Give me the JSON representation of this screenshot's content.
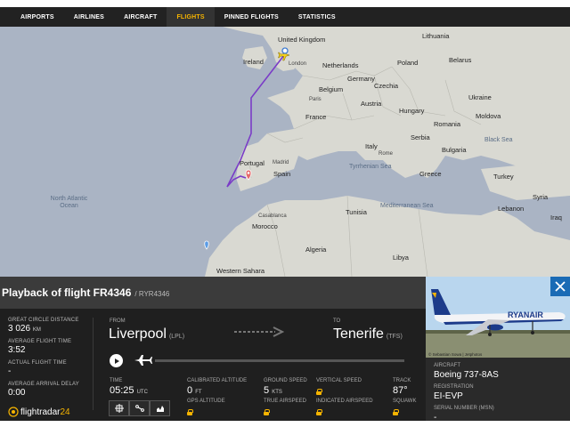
{
  "nav": {
    "items": [
      {
        "label": "AIRPORTS",
        "active": false
      },
      {
        "label": "AIRLINES",
        "active": false
      },
      {
        "label": "AIRCRAFT",
        "active": false
      },
      {
        "label": "FLIGHTS",
        "active": true
      },
      {
        "label": "PINNED FLIGHTS",
        "active": false
      },
      {
        "label": "STATISTICS",
        "active": false
      }
    ]
  },
  "map": {
    "countries": [
      "United Kingdom",
      "Ireland",
      "Netherlands",
      "Belgium",
      "Germany",
      "Poland",
      "Lithuania",
      "Belarus",
      "Czechia",
      "Ukraine",
      "France",
      "Austria",
      "Hungary",
      "Moldova",
      "Romania",
      "Italy",
      "Serbia",
      "Bulgaria",
      "Portugal",
      "Spain",
      "Greece",
      "Turkey",
      "Tunisia",
      "Morocco",
      "Algeria",
      "Libya",
      "Lebanon",
      "Syria",
      "Iraq",
      "Western Sahara"
    ],
    "seas": [
      "North Atlantic Ocean",
      "Black Sea",
      "Mediterranean Sea",
      "Tyrrhenian Sea"
    ],
    "cities": [
      "London",
      "Paris",
      "Madrid",
      "Rome",
      "Casablanca"
    ],
    "colors": {
      "land": "#d9d9d2",
      "water": "#aab4c4",
      "track": "#7a3cc7"
    }
  },
  "playback": {
    "title": "Playback of flight FR4346",
    "subtitle": "/ RYR4346"
  },
  "stats": {
    "distance_label": "GREAT CIRCLE DISTANCE",
    "distance_value": "3 026",
    "distance_unit": "KM",
    "avg_time_label": "AVERAGE FLIGHT TIME",
    "avg_time_value": "3:52",
    "actual_time_label": "ACTUAL FLIGHT TIME",
    "actual_time_value": "-",
    "avg_delay_label": "AVERAGE ARRIVAL DELAY",
    "avg_delay_value": "0:00"
  },
  "logo": {
    "text": "flightradar",
    "num": "24"
  },
  "route": {
    "from_label": "FROM",
    "from_city": "Liverpool",
    "from_code": "(LPL)",
    "to_label": "TO",
    "to_city": "Tenerife",
    "to_code": "(TFS)"
  },
  "timeline": {
    "progress": 0.0
  },
  "telemetry": {
    "time_label": "TIME",
    "time_value": "05:25",
    "time_unit": "UTC",
    "cal_alt_label": "CALIBRATED ALTITUDE",
    "cal_alt_value": "0",
    "cal_alt_unit": "FT",
    "gps_alt_label": "GPS ALTITUDE",
    "ground_speed_label": "GROUND SPEED",
    "ground_speed_value": "5",
    "ground_speed_unit": "KTS",
    "true_airspeed_label": "TRUE AIRSPEED",
    "vertical_speed_label": "VERTICAL SPEED",
    "indicated_airspeed_label": "INDICATED AIRSPEED",
    "track_label": "TRACK",
    "track_value": "87°",
    "squawk_label": "SQUAWK"
  },
  "aircraft": {
    "photo_credit": "© Sebastian Sowa | Jetphotos",
    "livery_text": "RYANAIR",
    "aircraft_label": "AIRCRAFT",
    "aircraft_value": "Boeing 737-8AS",
    "registration_label": "REGISTRATION",
    "registration_value": "EI-EVP",
    "serial_label": "SERIAL NUMBER (MSN)",
    "serial_value": "-"
  }
}
